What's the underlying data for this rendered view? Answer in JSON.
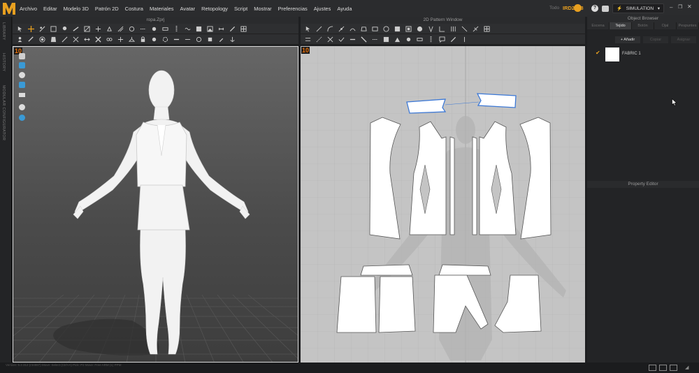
{
  "menu": [
    "Archivo",
    "Editar",
    "Modelo 3D",
    "Patrón 2D",
    "Costura",
    "Materiales",
    "Avatar",
    "Retopology",
    "Script",
    "Mostrar",
    "Preferencias",
    "Ajustes",
    "Ayuda"
  ],
  "user": {
    "label": "Todo",
    "name": "IRD2018"
  },
  "simulation_label": "SIMULATION",
  "left_tabs": [
    "LIBRARY",
    "HISTORY",
    "MODULAR CONFIGURATOR"
  ],
  "panel3d": {
    "title": "ropa.Zprj",
    "badge": "10"
  },
  "panel2d": {
    "title": "2D Pattern Window",
    "badge": "10"
  },
  "object_browser": {
    "title": "Object Browser",
    "tabs": [
      "Escena",
      "Tejido",
      "Botón",
      "Ojal",
      "Pespuntes"
    ],
    "active_tab": "Tejido",
    "actions": [
      "+ Añadir",
      "Copiar",
      "Asignar"
    ],
    "items": [
      {
        "name": "FABRIC 1",
        "color": "#ffffff"
      }
    ]
  },
  "property_editor": {
    "title": "Property Editor"
  },
  "status_text": "Version: 5.2.312 (r34987)   Move: Select (Ctrl+A)   Pick: P2   Move: Free  ARM (1)  PPM",
  "colors": {
    "accent": "#e8a020",
    "badge": "#e8700a",
    "selection": "#3d79d6"
  }
}
